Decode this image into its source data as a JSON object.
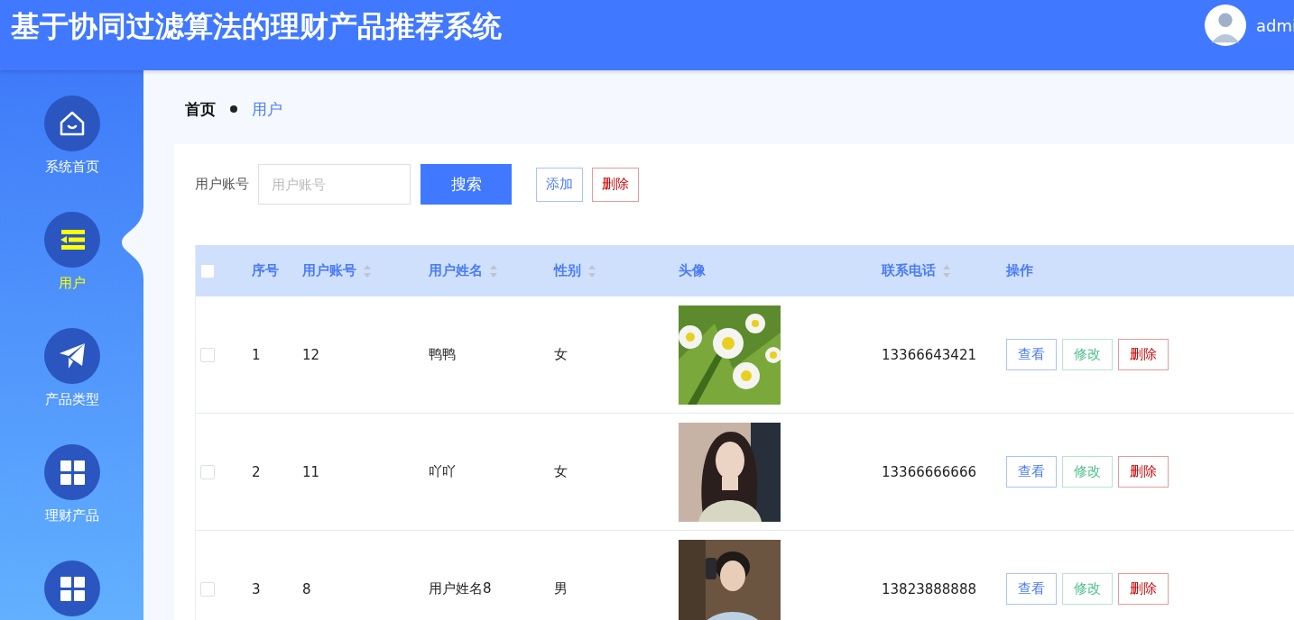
{
  "header": {
    "title": "基于协同过滤算法的理财产品推荐系统",
    "user": "admi"
  },
  "sidebar": {
    "items": [
      {
        "label": "系统首页",
        "selected": false
      },
      {
        "label": "用户",
        "selected": true
      },
      {
        "label": "产品类型",
        "selected": false
      },
      {
        "label": "理财产品",
        "selected": false
      },
      {
        "selected": false
      }
    ]
  },
  "breadcrumb": [
    {
      "label": "首页",
      "current": false
    },
    {
      "label": "用户",
      "current": true
    }
  ],
  "search": {
    "label": "用户账号",
    "placeholder": "用户账号",
    "button": "搜索"
  },
  "actions": [
    {
      "label": "添加",
      "kind": "add"
    },
    {
      "label": "删除",
      "kind": "delete"
    }
  ],
  "table": {
    "select_all": {
      "checked": false
    },
    "columns": [
      {
        "label": "序号",
        "sortable": false
      },
      {
        "label": "用户账号",
        "sortable": true
      },
      {
        "label": "用户姓名",
        "sortable": true
      },
      {
        "label": "性别",
        "sortable": true
      },
      {
        "label": "头像",
        "sortable": false
      },
      {
        "label": "联系电话",
        "sortable": true
      },
      {
        "label": "操作",
        "sortable": false
      }
    ],
    "rows": [
      {
        "checked": false,
        "index": "1",
        "account": "12",
        "name": "鸭鸭",
        "gender": "女",
        "phone": "13366643421",
        "buttons": [
          {
            "label": "查看",
            "kind": "view"
          },
          {
            "label": "修改",
            "kind": "edit"
          },
          {
            "label": "删除",
            "kind": "delete"
          }
        ]
      },
      {
        "checked": false,
        "index": "2",
        "account": "11",
        "name": "吖吖",
        "gender": "女",
        "phone": "13366666666",
        "buttons": [
          {
            "label": "查看",
            "kind": "view"
          },
          {
            "label": "修改",
            "kind": "edit"
          },
          {
            "label": "删除",
            "kind": "delete"
          }
        ]
      },
      {
        "checked": false,
        "index": "3",
        "account": "8",
        "name": "用户姓名8",
        "gender": "男",
        "phone": "13823888888",
        "buttons": [
          {
            "label": "查看",
            "kind": "view"
          },
          {
            "label": "修改",
            "kind": "edit"
          },
          {
            "label": "删除",
            "kind": "delete"
          }
        ]
      }
    ]
  }
}
